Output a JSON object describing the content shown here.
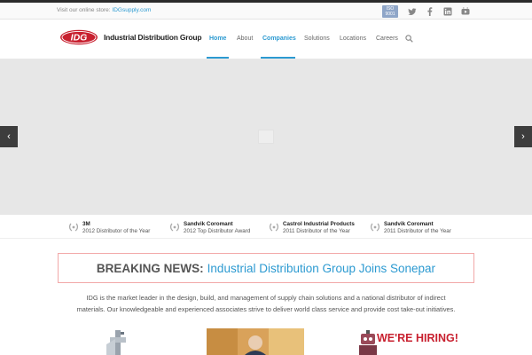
{
  "topbar": {
    "visit_text": "Visit our online store:",
    "store_link": "IDGsupply.com",
    "iso_badge": "ISO 9001",
    "social": [
      "twitter-icon",
      "facebook-icon",
      "linkedin-icon",
      "youtube-icon"
    ]
  },
  "header": {
    "logo_text": "IDG",
    "brand": "Industrial Distribution Group",
    "nav": [
      "Home",
      "About",
      "Companies",
      "Solutions",
      "Locations",
      "Careers"
    ]
  },
  "slider": {
    "prev": "‹",
    "next": "›"
  },
  "awards": [
    {
      "name": "3M",
      "desc": "2012 Distributor of the Year"
    },
    {
      "name": "Sandvik Coromant",
      "desc": "2012 Top Distributor Award"
    },
    {
      "name": "Castrol Industrial Products",
      "desc": "2011 Distributor of the Year"
    },
    {
      "name": "Sandvik Coromant",
      "desc": "2011 Distributor of the Year"
    }
  ],
  "news": {
    "label": "BREAKING NEWS:",
    "headline": "Industrial Distribution Group Joins Sonepar"
  },
  "intro": {
    "line1": "IDG is the market leader in the design, build, and management of supply chain solutions and a national distributor of indirect",
    "line2": "materials.  Our knowledgeable and experienced associates strive to deliver world class service and provide cost take-out initiatives."
  },
  "hiring": {
    "text": "WE'RE HIRING!"
  },
  "colors": {
    "accent": "#2c9ad1",
    "logo_red": "#c8202f",
    "news_border": "#f2a8a8"
  }
}
